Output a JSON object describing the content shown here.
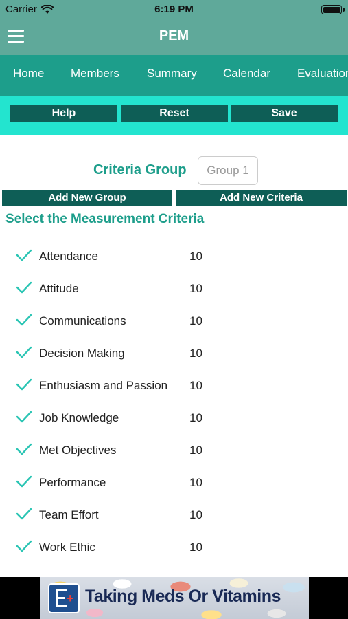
{
  "status_bar": {
    "carrier": "Carrier",
    "time": "6:19 PM"
  },
  "nav": {
    "title": "PEM"
  },
  "tabs": [
    {
      "label": "Home"
    },
    {
      "label": "Members"
    },
    {
      "label": "Summary"
    },
    {
      "label": "Calendar"
    },
    {
      "label": "Evaluation"
    }
  ],
  "actions": {
    "help": "Help",
    "reset": "Reset",
    "save": "Save"
  },
  "criteria_group": {
    "label": "Criteria Group",
    "placeholder": "Group 1"
  },
  "buttons": {
    "add_group": "Add New Group",
    "add_criteria": "Add New Criteria"
  },
  "section_title": "Select the Measurement Criteria",
  "criteria": [
    {
      "name": "Attendance",
      "value": "10",
      "checked": true
    },
    {
      "name": "Attitude",
      "value": "10",
      "checked": true
    },
    {
      "name": "Communications",
      "value": "10",
      "checked": true
    },
    {
      "name": "Decision Making",
      "value": "10",
      "checked": true
    },
    {
      "name": "Enthusiasm and Passion",
      "value": "10",
      "checked": true
    },
    {
      "name": "Job Knowledge",
      "value": "10",
      "checked": true
    },
    {
      "name": "Met Objectives",
      "value": "10",
      "checked": true
    },
    {
      "name": "Performance",
      "value": "10",
      "checked": true
    },
    {
      "name": "Team Effort",
      "value": "10",
      "checked": true
    },
    {
      "name": "Work Ethic",
      "value": "10",
      "checked": true
    }
  ],
  "ad": {
    "text": "Taking Meds Or Vitamins"
  },
  "colors": {
    "nav": "#5fa99a",
    "tabs": "#1d9e8b",
    "action_strip": "#23e4cf",
    "button": "#0e5e56",
    "accent_text": "#1d9e8b",
    "check": "#2bc5b4"
  },
  "icons": {
    "menu": "hamburger-icon",
    "wifi": "wifi-icon",
    "battery": "battery-icon",
    "check": "checkmark-icon"
  }
}
